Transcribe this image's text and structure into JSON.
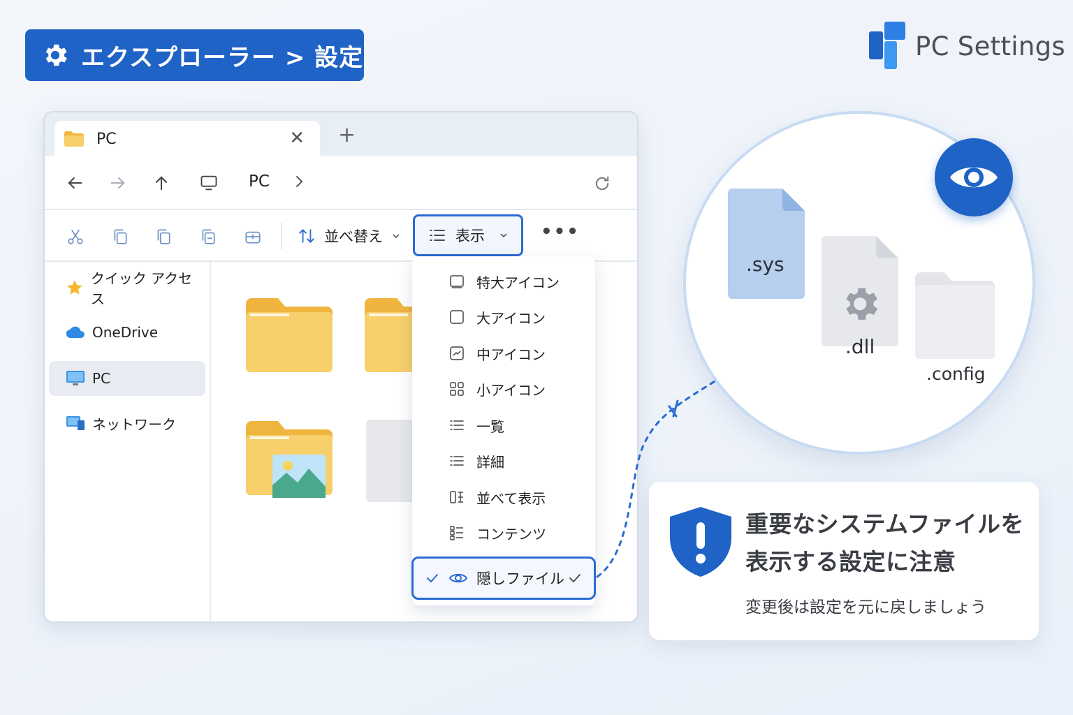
{
  "banner": {
    "title": "エクスプローラー > 設定"
  },
  "brand": {
    "name": "PC Settings"
  },
  "explorer": {
    "tab": {
      "label": "PC",
      "close": "✕"
    },
    "new_tab": "+",
    "address": {
      "location": "PC"
    },
    "toolbar": {
      "sort_label": "並べ替え",
      "view_label": "表示",
      "more": "•••"
    },
    "sidebar": [
      {
        "label": "クイック アクセス",
        "icon": "star-icon"
      },
      {
        "label": "OneDrive",
        "icon": "cloud-icon"
      },
      {
        "label": "PC",
        "icon": "monitor-icon",
        "active": true
      },
      {
        "label": "ネットワーク",
        "icon": "network-icon"
      }
    ]
  },
  "view_menu": {
    "items": [
      {
        "label": "特大アイコン",
        "icon": "extra-large-icons-icon"
      },
      {
        "label": "大アイコン",
        "icon": "large-icons-icon"
      },
      {
        "label": "中アイコン",
        "icon": "medium-icons-icon"
      },
      {
        "label": "小アイコン",
        "icon": "small-icons-icon"
      },
      {
        "label": "一覧",
        "icon": "list-icon"
      },
      {
        "label": "詳細",
        "icon": "details-icon"
      },
      {
        "label": "並べて表示",
        "icon": "tiles-icon"
      },
      {
        "label": "コンテンツ",
        "icon": "content-icon"
      }
    ],
    "hidden_files": {
      "label": "隠しファイル",
      "checked": true
    }
  },
  "zoom": {
    "files": [
      {
        "ext": ".sys",
        "color": "#b7cfee"
      },
      {
        "ext": ".dll",
        "color": "#e6e8ec"
      },
      {
        "ext": ".config",
        "color": "#eceef1"
      }
    ]
  },
  "warning": {
    "headline_1": "重要なシステムファイルを",
    "headline_2": "表示する設定に注意",
    "sub": "変更後は設定を元に戻しましょう"
  },
  "colors": {
    "accent": "#1f63c6",
    "accent_border": "#2b6bd2",
    "folder": "#f7cf6b",
    "folder_dark": "#efb53f"
  }
}
